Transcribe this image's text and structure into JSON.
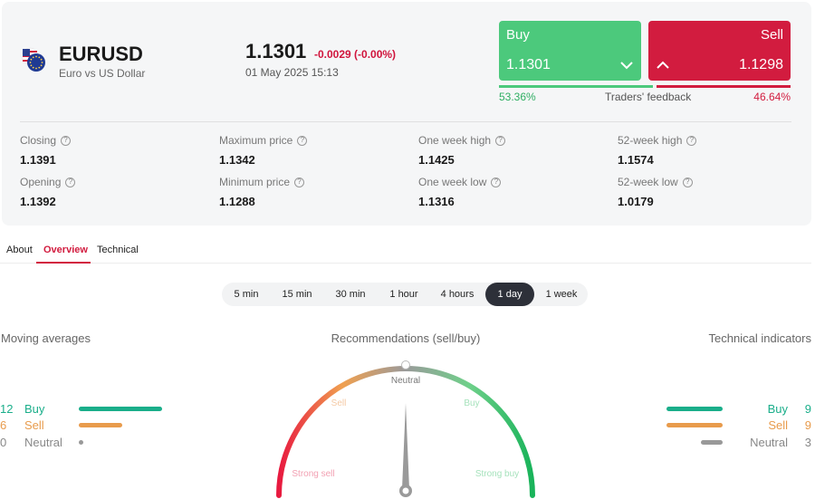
{
  "instrument": {
    "symbol": "EURUSD",
    "description": "Euro vs US Dollar",
    "price": "1.1301",
    "change": "-0.0029 (-0.00%)",
    "datetime": "01 May 2025 15:13",
    "flag_icon": "eu-us-flag-icon"
  },
  "trade": {
    "buy_label": "Buy",
    "buy_price": "1.1301",
    "sell_label": "Sell",
    "sell_price": "1.1298",
    "buy_icon": "chevron-down-icon",
    "sell_icon": "chevron-up-icon"
  },
  "feedback": {
    "buy_pct": "53.36%",
    "sell_pct": "46.64%",
    "label": "Traders' feedback",
    "buy_fraction": 0.5336,
    "sell_fraction": 0.4664
  },
  "stats": [
    {
      "label": "Closing",
      "value": "1.1391"
    },
    {
      "label": "Maximum price",
      "value": "1.1342"
    },
    {
      "label": "One week high",
      "value": "1.1425"
    },
    {
      "label": "52-week high",
      "value": "1.1574"
    },
    {
      "label": "Opening",
      "value": "1.1392"
    },
    {
      "label": "Minimum price",
      "value": "1.1288"
    },
    {
      "label": "One week low",
      "value": "1.1316"
    },
    {
      "label": "52-week low",
      "value": "1.0179"
    }
  ],
  "tabs": {
    "about": "About",
    "overview": "Overview",
    "technical": "Technical",
    "active": "Overview"
  },
  "periods": {
    "items": [
      "5 min",
      "15 min",
      "30 min",
      "1 hour",
      "4 hours",
      "1 day",
      "1 week"
    ],
    "active": "1 day"
  },
  "moving_averages": {
    "title": "Moving averages",
    "rows": [
      {
        "count": "12",
        "label": "Buy",
        "color": "#1aae8a"
      },
      {
        "count": "6",
        "label": "Sell",
        "color": "#e89b4c"
      },
      {
        "count": "0",
        "label": "Neutral",
        "color": "#999999"
      }
    ]
  },
  "recommendations": {
    "title": "Recommendations (sell/buy)",
    "neutral": "Neutral",
    "sell": "Sell",
    "buy": "Buy",
    "strong_sell": "Strong sell",
    "strong_buy": "Strong buy",
    "needle_value": 0.5
  },
  "technical_indicators": {
    "title": "Technical indicators",
    "rows": [
      {
        "count": "9",
        "label": "Buy",
        "color": "#1aae8a"
      },
      {
        "count": "9",
        "label": "Sell",
        "color": "#e89b4c"
      },
      {
        "count": "3",
        "label": "Neutral",
        "color": "#999999"
      }
    ]
  },
  "colors": {
    "buy": "#4cc97c",
    "sell": "#d21c3f",
    "accent": "#d21c3f"
  }
}
